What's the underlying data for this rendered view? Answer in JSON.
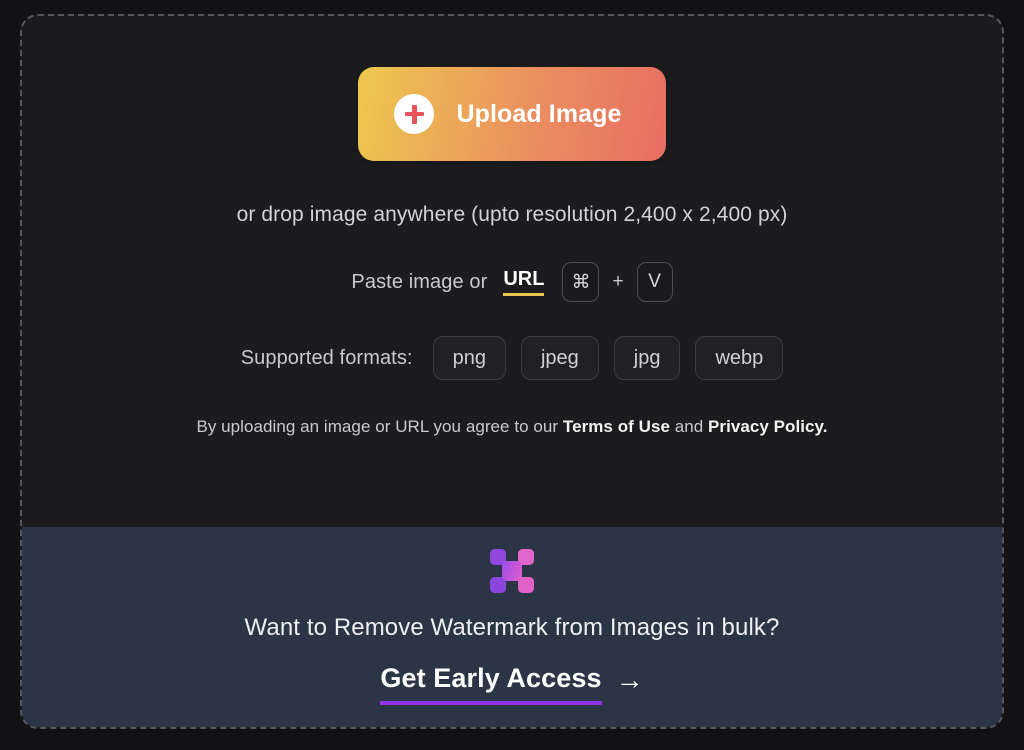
{
  "dropzone": {
    "upload_button": {
      "label": "Upload Image",
      "icon": "plus-icon",
      "gradient_from": "#edc84e",
      "gradient_to": "#e86e63"
    },
    "drop_hint": "or drop image anywhere (upto resolution 2,400 x 2,400 px)",
    "paste": {
      "prefix": "Paste image or",
      "link_label": "URL",
      "link_underline_color": "#e8c84e",
      "key_modifier": "⌘",
      "key_plus": "+",
      "key_letter": "V"
    },
    "formats": {
      "label": "Supported formats:",
      "items": [
        "png",
        "jpeg",
        "jpg",
        "webp"
      ]
    },
    "legal": {
      "prefix": "By uploading an image or URL you agree to our",
      "terms_label": "Terms of Use",
      "conjunction": "and",
      "privacy_label": "Privacy Policy."
    }
  },
  "banner": {
    "background": "#2b3545",
    "logo_name": "app-logo-icon",
    "title": "Want to Remove Watermark from Images in bulk?",
    "cta_label": "Get Early Access",
    "cta_arrow": "→",
    "cta_underline_color": "#9333ea"
  }
}
